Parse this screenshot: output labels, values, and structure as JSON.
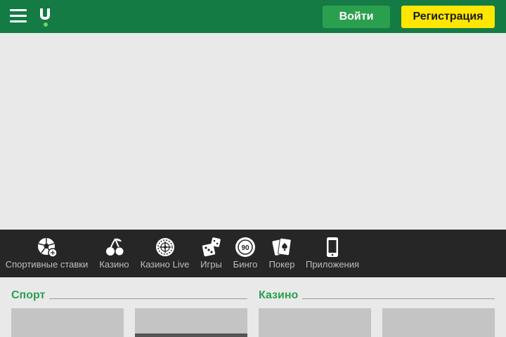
{
  "header": {
    "login_label": "Войти",
    "register_label": "Регистрация"
  },
  "categories": [
    {
      "label": "Спортивные ставки",
      "icon": "soccer-ball-icon"
    },
    {
      "label": "Казино",
      "icon": "cherries-icon"
    },
    {
      "label": "Казино Live",
      "icon": "roulette-wheel-icon"
    },
    {
      "label": "Игры",
      "icon": "dice-icon"
    },
    {
      "label": "Бинго",
      "icon": "bingo-ball-icon"
    },
    {
      "label": "Покер",
      "icon": "playing-cards-icon"
    },
    {
      "label": "Приложения",
      "icon": "smartphone-icon"
    }
  ],
  "sections": [
    {
      "title": "Спорт"
    },
    {
      "title": "Казино"
    }
  ],
  "colors": {
    "header_bg": "#147b45",
    "accent_green": "#2aa04f",
    "register_yellow": "#ffe600",
    "nav_bg": "#262626"
  }
}
